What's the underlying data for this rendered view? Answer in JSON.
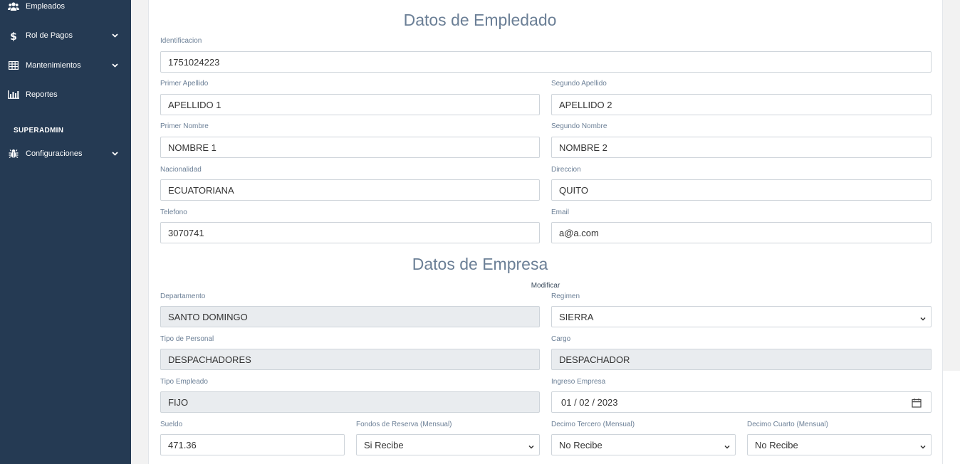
{
  "sidebar": {
    "items": [
      {
        "label": "Empleados",
        "icon": "users-icon"
      },
      {
        "label": "Rol de Pagos",
        "icon": "dollar-icon"
      },
      {
        "label": "Mantenimientos",
        "icon": "table-icon"
      },
      {
        "label": "Reportes",
        "icon": "bar-chart-icon"
      }
    ],
    "section_heading": "SUPERADMIN",
    "admin_items": [
      {
        "label": "Configuraciones",
        "icon": "bug-icon"
      }
    ]
  },
  "employee_section": {
    "title": "Datos de Empledado",
    "identificacion": {
      "label": "Identificacion",
      "value": "1751024223"
    },
    "primer_apellido": {
      "label": "Primer Apellido",
      "value": "APELLIDO 1"
    },
    "segundo_apellido": {
      "label": "Segundo Apellido",
      "value": "APELLIDO 2"
    },
    "primer_nombre": {
      "label": "Primer Nombre",
      "value": "NOMBRE 1"
    },
    "segundo_nombre": {
      "label": "Segundo Nombre",
      "value": "NOMBRE 2"
    },
    "nacionalidad": {
      "label": "Nacionalidad",
      "value": "ECUATORIANA"
    },
    "direccion": {
      "label": "Direccion",
      "value": "QUITO"
    },
    "telefono": {
      "label": "Telefono",
      "value": "3070741"
    },
    "email": {
      "label": "Email",
      "value": "a@a.com"
    }
  },
  "company_section": {
    "title": "Datos de Empresa",
    "modify_label": "Modificar",
    "departamento": {
      "label": "Departamento",
      "value": "SANTO DOMINGO"
    },
    "regimen": {
      "label": "Regimen",
      "value": "SIERRA"
    },
    "tipo_personal": {
      "label": "Tipo de Personal",
      "value": "DESPACHADORES"
    },
    "cargo": {
      "label": "Cargo",
      "value": "DESPACHADOR"
    },
    "tipo_empleado": {
      "label": "Tipo Empleado",
      "value": "FIJO"
    },
    "ingreso_empresa": {
      "label": "Ingreso Empresa",
      "value": "01 / 02 / 2023"
    },
    "sueldo": {
      "label": "Sueldo",
      "value": "471.36"
    },
    "fondos_reserva": {
      "label": "Fondos de Reserva (Mensual)",
      "value": "Si Recibe"
    },
    "decimo_tercero": {
      "label": "Decimo Tercero (Mensual)",
      "value": "No Recibe"
    },
    "decimo_cuarto": {
      "label": "Decimo Cuarto (Mensual)",
      "value": "No Recibe"
    }
  }
}
